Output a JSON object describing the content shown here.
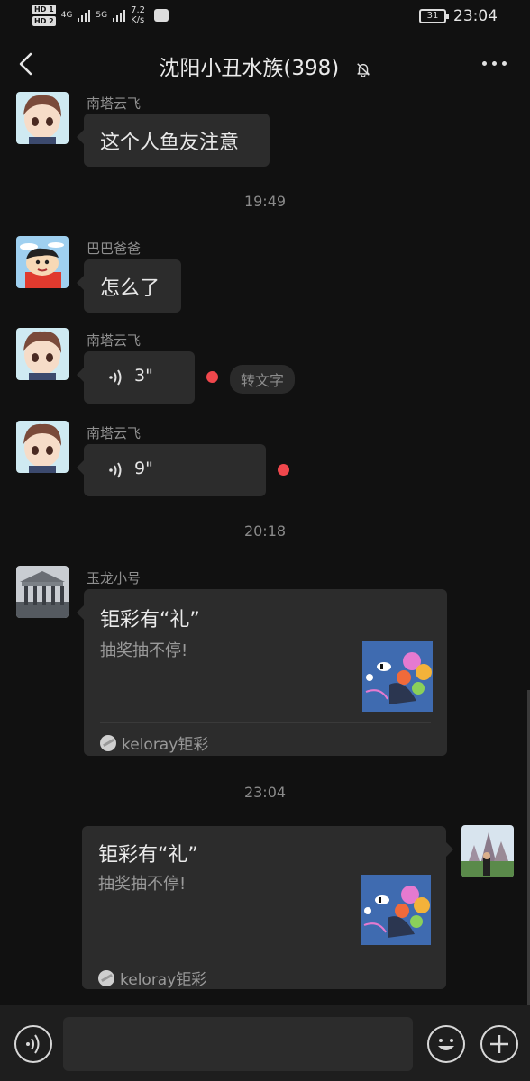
{
  "status_bar": {
    "hd1": "HD 1",
    "hd2": "HD 2",
    "net1": "4G",
    "net2": "5G",
    "speed_value": "7.2",
    "speed_unit": "K/s",
    "battery": "31",
    "time": "23:04"
  },
  "header": {
    "title": "沈阳小丑水族(398)",
    "icons": [
      "back-arrow-icon",
      "mute-bell-icon",
      "more-icon"
    ]
  },
  "messages": [
    {
      "type": "text",
      "sender": "南塔云飞",
      "text": "这个人鱼友注意"
    },
    {
      "type": "timestamp",
      "text": "19:49"
    },
    {
      "type": "text",
      "sender": "巴巴爸爸",
      "text": "怎么了"
    },
    {
      "type": "voice",
      "sender": "南塔云飞",
      "duration": "3\"",
      "unread": true,
      "transcribe_label": "转文字"
    },
    {
      "type": "voice",
      "sender": "南塔云飞",
      "duration": "9\"",
      "unread": true
    },
    {
      "type": "timestamp",
      "text": "20:18"
    },
    {
      "type": "card",
      "sender": "玉龙小号",
      "title": "钜彩有“礼”",
      "desc": "抽奖抽不停!",
      "source": "keloray钜彩"
    },
    {
      "type": "timestamp",
      "text": "23:04"
    },
    {
      "type": "card",
      "sender": "",
      "self": true,
      "title": "钜彩有“礼”",
      "desc": "抽奖抽不停!",
      "source": "keloray钜彩"
    }
  ],
  "input": {
    "value": "",
    "icons": [
      "voice-input-icon",
      "emoji-icon",
      "plus-icon"
    ]
  },
  "colors": {
    "background": "#111111",
    "bubble": "#2c2c2c",
    "unread_dot": "#f0474c",
    "meta_text": "#8a8a8a"
  }
}
